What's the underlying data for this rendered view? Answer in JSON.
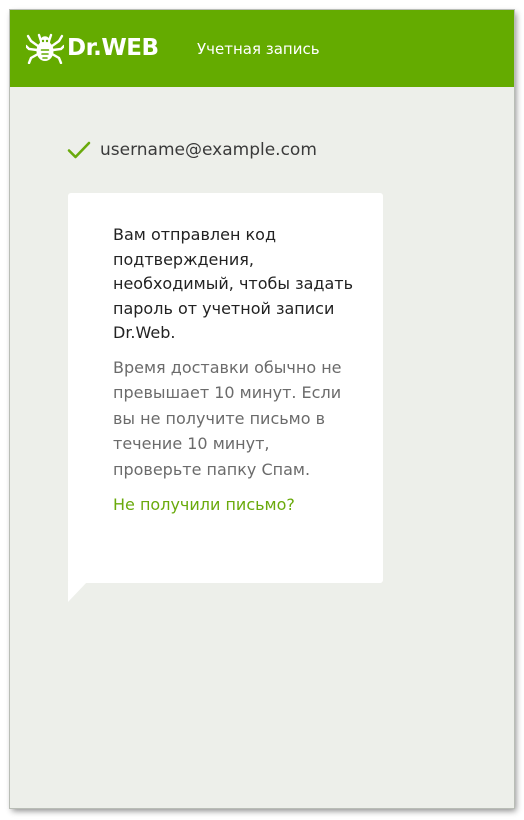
{
  "header": {
    "brand": "Dr.WEB",
    "title": "Учетная запись",
    "logo_icon": "spider-logo-icon",
    "background_color": "#64ab00"
  },
  "account": {
    "email": "username@example.com",
    "status_icon": "check-icon",
    "status_color": "#6aaa0c"
  },
  "message": {
    "main": "Вам отправлен код подтверждения, необходимый, чтобы задать пароль от учетной записи Dr.Web.",
    "delivery_note": "Время доставки обычно не превышает 10 минут. Если вы не получите письмо в течение 10 минут, проверьте папку Спам.",
    "resend_link": "Не получили письмо?",
    "link_color": "#6aaa0c"
  }
}
